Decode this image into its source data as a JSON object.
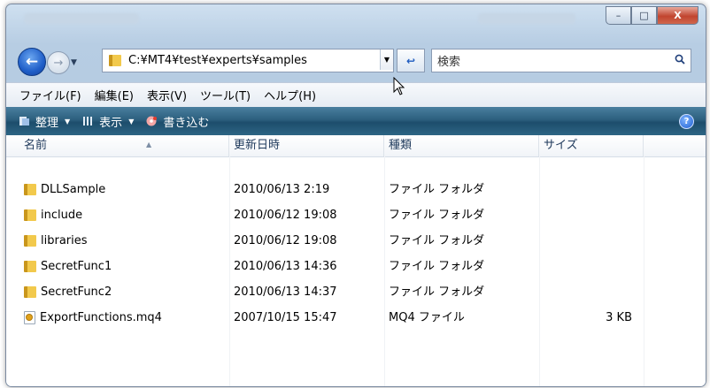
{
  "window": {
    "caption_buttons": {
      "minimize": "–",
      "maximize": "□",
      "close": "X"
    }
  },
  "nav": {
    "back_glyph": "←",
    "forward_glyph": "→",
    "address": "C:¥MT4¥test¥experts¥samples",
    "refresh_glyph": "↩",
    "search_placeholder": "検索"
  },
  "menu": [
    "ファイル(F)",
    "編集(E)",
    "表示(V)",
    "ツール(T)",
    "ヘルプ(H)"
  ],
  "toolbar": {
    "organize": "整理",
    "views": "表示",
    "burn": "書き込む",
    "help": "?"
  },
  "columns": [
    "名前",
    "更新日時",
    "種類",
    "サイズ"
  ],
  "files": [
    {
      "name": "DLLSample",
      "modified": "2010/06/13 2:19",
      "type": "ファイル フォルダ",
      "size": "",
      "icon": "folder-icon"
    },
    {
      "name": "include",
      "modified": "2010/06/12 19:08",
      "type": "ファイル フォルダ",
      "size": "",
      "icon": "folder-icon"
    },
    {
      "name": "libraries",
      "modified": "2010/06/12 19:08",
      "type": "ファイル フォルダ",
      "size": "",
      "icon": "folder-icon"
    },
    {
      "name": "SecretFunc1",
      "modified": "2010/06/13 14:36",
      "type": "ファイル フォルダ",
      "size": "",
      "icon": "folder-icon"
    },
    {
      "name": "SecretFunc2",
      "modified": "2010/06/13 14:37",
      "type": "ファイル フォルダ",
      "size": "",
      "icon": "folder-icon"
    },
    {
      "name": "ExportFunctions.mq4",
      "modified": "2007/10/15 15:47",
      "type": "MQ4 ファイル",
      "size": "3 KB",
      "icon": "mq4-file-icon"
    }
  ],
  "colors": {
    "toolbar_bg": "#2c5f7e",
    "header_text": "#1e395b",
    "close_button": "#c1452f"
  }
}
